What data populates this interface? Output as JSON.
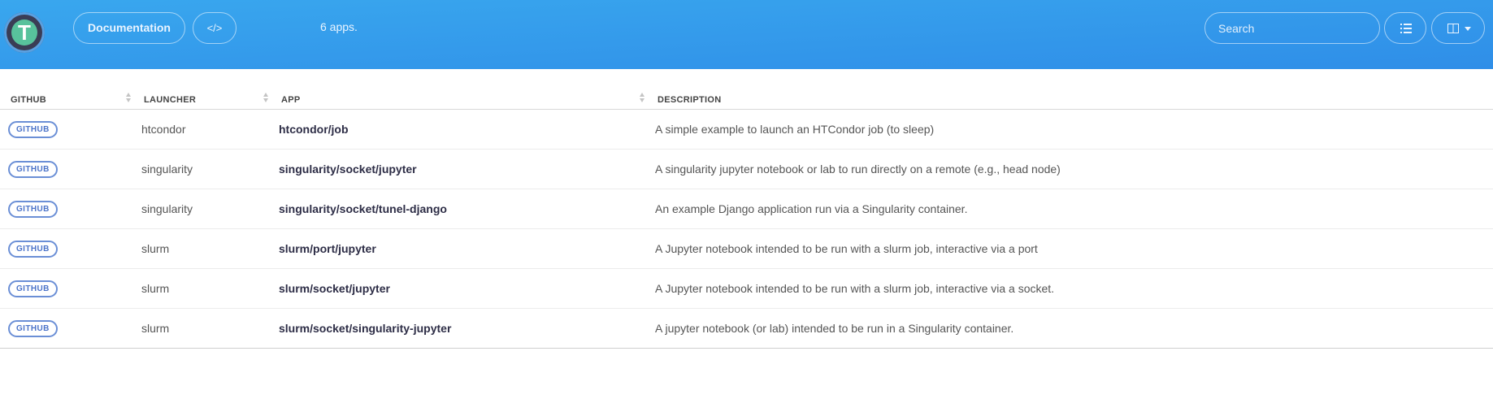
{
  "header": {
    "logo_letter": "T",
    "documentation_label": "Documentation",
    "code_label": "</>",
    "app_count": "6 apps.",
    "search_placeholder": "Search"
  },
  "table": {
    "columns": [
      "GITHUB",
      "LAUNCHER",
      "APP",
      "DESCRIPTION"
    ],
    "rows": [
      {
        "github": "GITHUB",
        "launcher": "htcondor",
        "app": "htcondor/job",
        "description": "A simple example to launch an HTCondor job (to sleep)"
      },
      {
        "github": "GITHUB",
        "launcher": "singularity",
        "app": "singularity/socket/jupyter",
        "description": "A singularity jupyter notebook or lab to run directly on a remote (e.g., head node)"
      },
      {
        "github": "GITHUB",
        "launcher": "singularity",
        "app": "singularity/socket/tunel-django",
        "description": "An example Django application run via a Singularity container."
      },
      {
        "github": "GITHUB",
        "launcher": "slurm",
        "app": "slurm/port/jupyter",
        "description": "A Jupyter notebook intended to be run with a slurm job, interactive via a port"
      },
      {
        "github": "GITHUB",
        "launcher": "slurm",
        "app": "slurm/socket/jupyter",
        "description": "A Jupyter notebook intended to be run with a slurm job, interactive via a socket."
      },
      {
        "github": "GITHUB",
        "launcher": "slurm",
        "app": "slurm/socket/singularity-jupyter",
        "description": "A jupyter notebook (or lab) intended to be run in a Singularity container."
      }
    ]
  },
  "icons": {
    "list": "list-icon",
    "columns": "columns-icon",
    "caret": "caret-down-icon",
    "sort": "sort-icon"
  },
  "colors": {
    "header_gradient_start": "#39a7ee",
    "header_gradient_end": "#2f8ee8",
    "github_badge": "#4c74c9",
    "logo_green": "#58c29c"
  }
}
